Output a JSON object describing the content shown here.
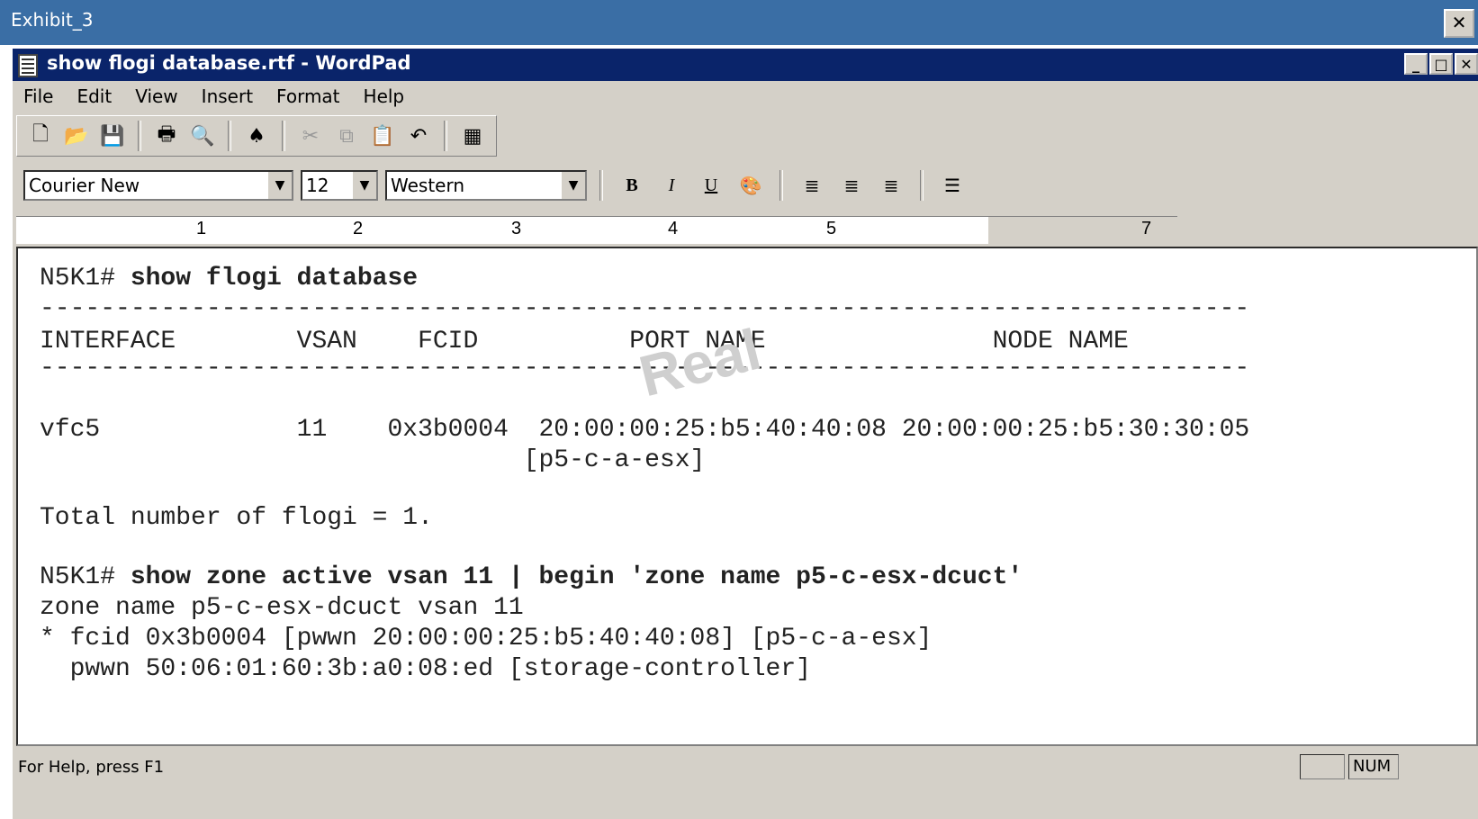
{
  "outer_window": {
    "title": "Exhibit_3",
    "close": "✕"
  },
  "window": {
    "title": "show flogi database.rtf - WordPad",
    "min": "_",
    "max": "□",
    "close": "✕"
  },
  "menu": [
    "File",
    "Edit",
    "View",
    "Insert",
    "Format",
    "Help"
  ],
  "toolbar": {
    "icons": [
      "new-icon",
      "open-icon",
      "save-icon",
      "print-icon",
      "print-preview-icon",
      "find-icon",
      "cut-icon",
      "copy-icon",
      "paste-icon",
      "undo-icon",
      "datetime-icon"
    ],
    "glyphs": [
      "🗋",
      "📂",
      "💾",
      "🖶",
      "🔍",
      "♠",
      "✂",
      "⧉",
      "📋",
      "↶",
      "▦"
    ]
  },
  "format": {
    "font": "Courier New",
    "size": "12",
    "script": "Western",
    "bold": "B",
    "italic": "I",
    "underline": "U",
    "color_glyph": "🎨",
    "align_glyph": "≣",
    "bullets_glyph": "☰"
  },
  "ruler": [
    "1",
    "2",
    "3",
    "4",
    "5",
    "7"
  ],
  "document": {
    "prompt1": "N5K1# ",
    "cmd1": "show flogi database",
    "dashes": "--------------------------------------------------------------------------------",
    "header": "INTERFACE        VSAN    FCID          PORT NAME               NODE NAME",
    "row1": "vfc5             11    0x3b0004  20:00:00:25:b5:40:40:08 20:00:00:25:b5:30:30:05",
    "row1b": "                                [p5-c-a-esx]",
    "total": "Total number of flogi = 1.",
    "prompt2": "N5K1# ",
    "cmd2": "show zone active vsan 11 | begin 'zone name p5-c-esx-dcuct'",
    "zone1": "zone name p5-c-esx-dcuct vsan 11",
    "zone2": "* fcid 0x3b0004 [pwwn 20:00:00:25:b5:40:40:08] [p5-c-a-esx]",
    "zone3": "  pwwn 50:06:01:60:3b:a0:08:ed [storage-controller]",
    "watermark": "Real"
  },
  "status": {
    "help": "For Help, press F1",
    "num": "NUM"
  }
}
